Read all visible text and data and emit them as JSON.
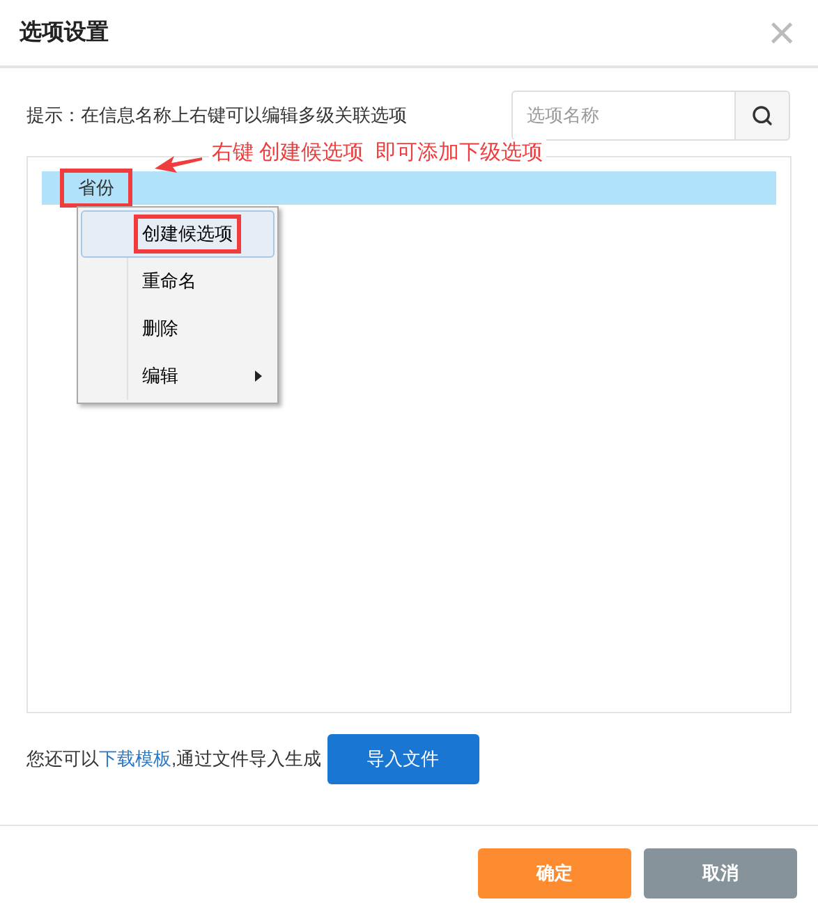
{
  "dialog": {
    "title": "选项设置",
    "close": "×"
  },
  "hint": "提示：在信息名称上右键可以编辑多级关联选项",
  "search": {
    "placeholder": "选项名称"
  },
  "annotation": {
    "text": "右键 创建候选项  即可添加下级选项"
  },
  "tree": {
    "nodes": [
      {
        "label": "省份",
        "selected": true,
        "annotated": true
      }
    ]
  },
  "context_menu": {
    "items": [
      {
        "label": "创建候选项",
        "kind": "action",
        "selected": true,
        "annotated": true
      },
      {
        "label": "重命名",
        "kind": "action",
        "selected": false,
        "annotated": false
      },
      {
        "label": "删除",
        "kind": "action",
        "selected": false,
        "annotated": false
      },
      {
        "label": "编辑",
        "kind": "submenu",
        "selected": false,
        "annotated": false
      }
    ]
  },
  "import": {
    "prefix": "您还可以",
    "link": "下载模板",
    "suffix": ",通过文件导入生成",
    "button": "导入文件"
  },
  "buttons": [
    {
      "label": "确定",
      "kind": "primary"
    },
    {
      "label": "取消",
      "kind": "secondary"
    }
  ]
}
